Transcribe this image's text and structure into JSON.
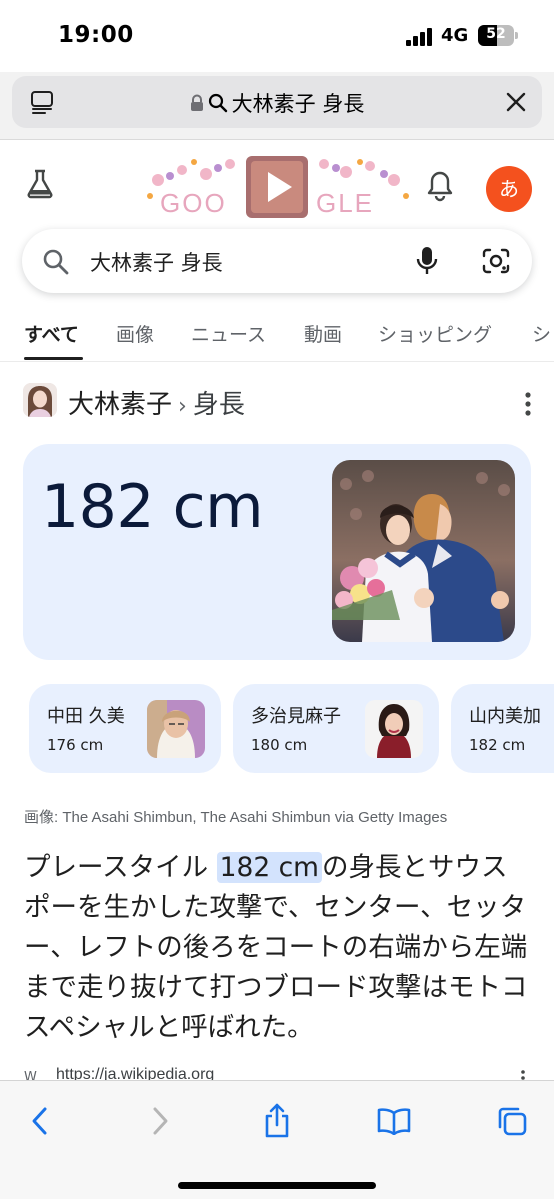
{
  "status_bar": {
    "time": "19:00",
    "network": "4G",
    "battery_level": "52"
  },
  "browser": {
    "address_text": "大林素子 身長",
    "menu_icon": "page-menu-icon",
    "lock_icon": "lock-icon",
    "close_icon": "close-icon"
  },
  "google": {
    "doodle_letters": "GOOGLE",
    "avatar_letter": "あ",
    "search_query": "大林素子 身長",
    "tabs": [
      "すべて",
      "画像",
      "ニュース",
      "動画",
      "ショッピング",
      "シ"
    ],
    "active_tab": 0
  },
  "entity": {
    "name": "大林素子",
    "separator": "›",
    "attribute": "身長"
  },
  "answer": {
    "value": "182 cm"
  },
  "related": [
    {
      "name": "中田 久美",
      "height": "176 cm"
    },
    {
      "name": "多治見麻子",
      "height": "180 cm"
    },
    {
      "name": "山内美加",
      "height": "182 cm"
    }
  ],
  "image_credit": "画像: The Asahi Shimbun, The Asahi Shimbun via Getty Images",
  "snippet": {
    "before": "プレースタイル ",
    "highlight": "182 cm",
    "after": "の身長とサウスポーを生かした攻撃で、センター、セッター、レフトの後ろをコートの右端から左端まで走り抜けて打つブロード攻撃はモトコスペシャルと呼ばれた。"
  },
  "source": {
    "favicon": "W",
    "url": "https://ja.wikipedia.org"
  },
  "colors": {
    "card_bg": "#e8f0fe",
    "highlight_bg": "#d3e3fd",
    "safari_blue": "#1a73e8",
    "avatar": "#f4511e"
  }
}
